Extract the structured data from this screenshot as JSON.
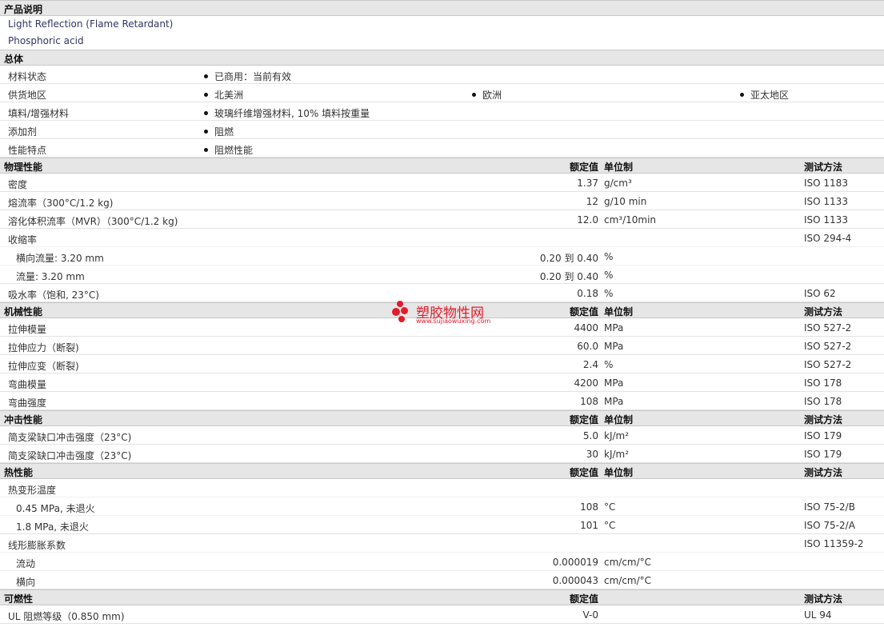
{
  "headers": {
    "value": "额定值",
    "unit": "单位制",
    "method": "测试方法"
  },
  "description": {
    "title": "产品说明",
    "lines": [
      "Light Reflection (Flame Retardant)",
      "Phosphoric acid"
    ]
  },
  "general": {
    "title": "总体",
    "rows": [
      {
        "label": "材料状态",
        "items": [
          "已商用：当前有效"
        ]
      },
      {
        "label": "供货地区",
        "items": [
          "北美洲",
          "欧洲",
          "亚太地区"
        ]
      },
      {
        "label": "填料/增强材料",
        "items": [
          "玻璃纤维增强材料, 10% 填料按重量"
        ]
      },
      {
        "label": "添加剂",
        "items": [
          "阻燃"
        ]
      },
      {
        "label": "性能特点",
        "items": [
          "阻燃性能"
        ]
      }
    ]
  },
  "physical": {
    "title": "物理性能",
    "rows": [
      {
        "label": "密度",
        "value": "1.37",
        "unit": "g/cm³",
        "method": "ISO 1183"
      },
      {
        "label": "熔流率（300°C/1.2 kg)",
        "value": "12",
        "unit": "g/10 min",
        "method": "ISO 1133"
      },
      {
        "label": "溶化体积流率（MVR）（300°C/1.2 kg)",
        "value": "12.0",
        "unit": "cm³/10min",
        "method": "ISO 1133"
      },
      {
        "label": "收缩率",
        "value": "",
        "unit": "",
        "method": "ISO 294-4"
      },
      {
        "label": "横向流量: 3.20 mm",
        "value": "0.20 到 0.40",
        "unit": "%",
        "method": ""
      },
      {
        "label": "流量: 3.20 mm",
        "value": "0.20 到 0.40",
        "unit": "%",
        "method": ""
      },
      {
        "label": "吸水率（饱和, 23°C)",
        "value": "0.18",
        "unit": "%",
        "method": "ISO 62"
      }
    ]
  },
  "mechanical": {
    "title": "机械性能",
    "rows": [
      {
        "label": "拉伸模量",
        "value": "4400",
        "unit": "MPa",
        "method": "ISO 527-2"
      },
      {
        "label": "拉伸应力（断裂)",
        "value": "60.0",
        "unit": "MPa",
        "method": "ISO 527-2"
      },
      {
        "label": "拉伸应变（断裂)",
        "value": "2.4",
        "unit": "%",
        "method": "ISO 527-2"
      },
      {
        "label": "弯曲模量",
        "value": "4200",
        "unit": "MPa",
        "method": "ISO 178"
      },
      {
        "label": "弯曲强度",
        "value": "108",
        "unit": "MPa",
        "method": "ISO 178"
      }
    ]
  },
  "impact": {
    "title": "冲击性能",
    "rows": [
      {
        "label": "简支梁缺口冲击强度（23°C)",
        "value": "5.0",
        "unit": "kJ/m²",
        "method": "ISO 179"
      },
      {
        "label": "简支梁缺口冲击强度（23°C)",
        "value": "30",
        "unit": "kJ/m²",
        "method": "ISO 179"
      }
    ]
  },
  "thermal": {
    "title": "热性能",
    "rows": [
      {
        "label": "热变形温度",
        "value": "",
        "unit": "",
        "method": ""
      },
      {
        "label": "0.45 MPa, 未退火",
        "value": "108",
        "unit": "°C",
        "method": "ISO 75-2/B"
      },
      {
        "label": "1.8 MPa, 未退火",
        "value": "101",
        "unit": "°C",
        "method": "ISO 75-2/A"
      },
      {
        "label": "线形膨胀系数",
        "value": "",
        "unit": "",
        "method": "ISO 11359-2"
      },
      {
        "label": "流动",
        "value": "0.000019",
        "unit": "cm/cm/°C",
        "method": ""
      },
      {
        "label": "横向",
        "value": "0.000043",
        "unit": "cm/cm/°C",
        "method": ""
      }
    ]
  },
  "flammability": {
    "title": "可燃性",
    "rows": [
      {
        "label": "UL 阻燃等级（0.850 mm)",
        "value": "V-0",
        "unit": "",
        "method": "UL 94"
      }
    ]
  },
  "watermark": {
    "name": "塑胶物性网",
    "url": "www.sujiaowuxing.com",
    "color": "#e21b2a"
  }
}
